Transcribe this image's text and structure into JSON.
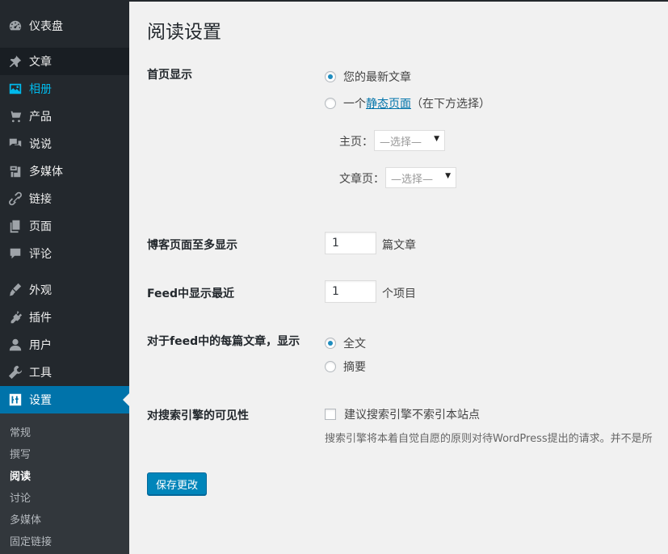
{
  "sidebar": {
    "items": [
      {
        "label": "仪表盘",
        "icon": "dashboard-icon"
      },
      {
        "label": "文章",
        "icon": "pin-icon"
      },
      {
        "label": "相册",
        "icon": "gallery-icon"
      },
      {
        "label": "产品",
        "icon": "cart-icon"
      },
      {
        "label": "说说",
        "icon": "comments-icon"
      },
      {
        "label": "多媒体",
        "icon": "media-icon"
      },
      {
        "label": "链接",
        "icon": "link-icon"
      },
      {
        "label": "页面",
        "icon": "page-icon"
      },
      {
        "label": "评论",
        "icon": "comment-icon"
      },
      {
        "label": "外观",
        "icon": "appearance-icon"
      },
      {
        "label": "插件",
        "icon": "plugin-icon"
      },
      {
        "label": "用户",
        "icon": "user-icon"
      },
      {
        "label": "工具",
        "icon": "wrench-icon"
      },
      {
        "label": "设置",
        "icon": "settings-icon"
      }
    ],
    "submenu": [
      "常规",
      "撰写",
      "阅读",
      "讨论",
      "多媒体",
      "固定链接"
    ]
  },
  "page": {
    "title": "阅读设置",
    "front_page": {
      "label": "首页显示",
      "option_latest": "您的最新文章",
      "option_static_prefix": "一个",
      "option_static_link": "静态页面",
      "option_static_suffix": "（在下方选择）",
      "homepage_label": "主页：",
      "homepage_select": "—选择—",
      "postspage_label": "文章页：",
      "postspage_select": "—选择—"
    },
    "blog_pages": {
      "label": "博客页面至多显示",
      "value": "1",
      "suffix": "篇文章"
    },
    "feed_recent": {
      "label": "Feed中显示最近",
      "value": "1",
      "suffix": "个项目"
    },
    "feed_article": {
      "label": "对于feed中的每篇文章，显示",
      "option_full": "全文",
      "option_summary": "摘要"
    },
    "search_visibility": {
      "label": "对搜索引擎的可见性",
      "checkbox_label": "建议搜索引擎不索引本站点",
      "description": "搜索引擎将本着自觉自愿的原则对待WordPress提出的请求。并不是所"
    },
    "save_button": "保存更改"
  }
}
